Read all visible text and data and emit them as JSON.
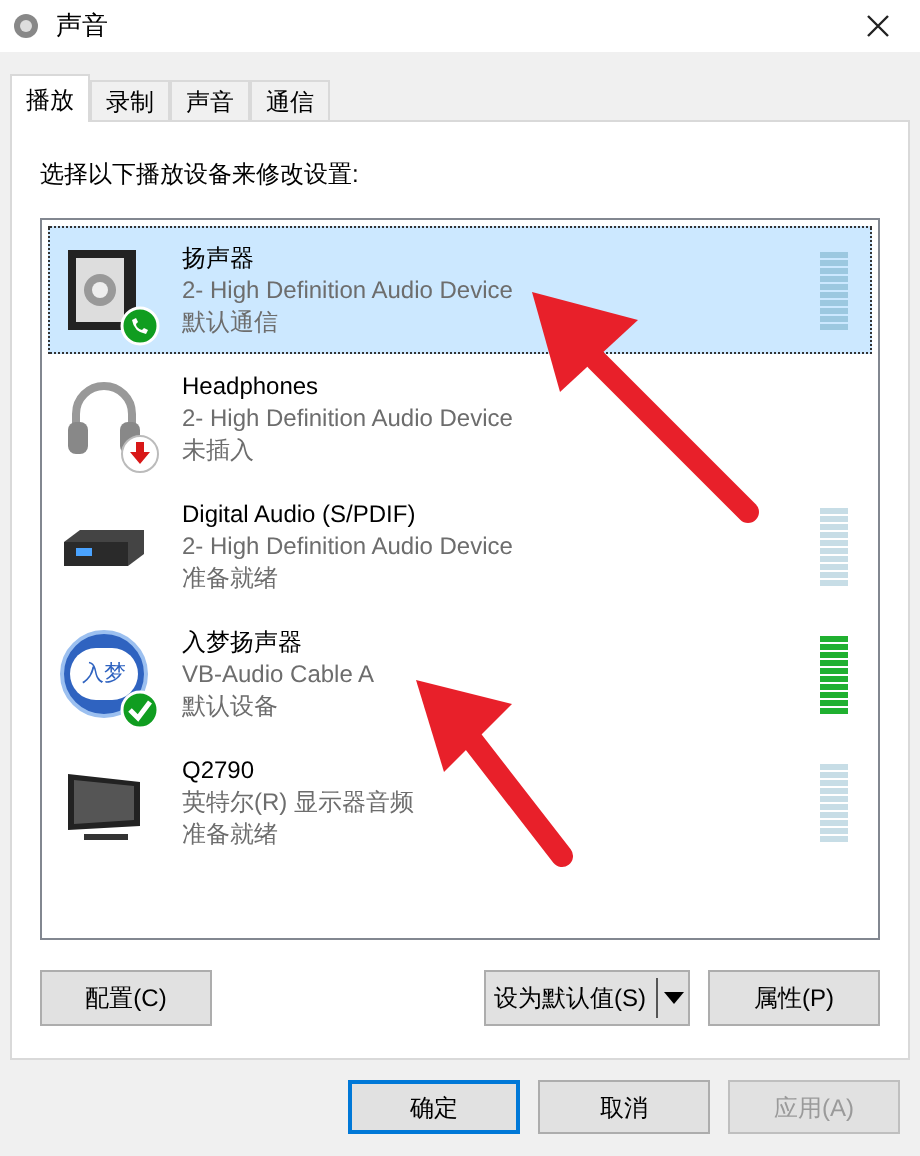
{
  "window": {
    "title": "声音"
  },
  "tabs": [
    {
      "label": "播放",
      "selected": true
    },
    {
      "label": "录制",
      "selected": false
    },
    {
      "label": "声音",
      "selected": false
    },
    {
      "label": "通信",
      "selected": false
    }
  ],
  "instruction": "选择以下播放设备来修改设置:",
  "devices": [
    {
      "kind": "speaker",
      "name": "扬声器",
      "driver": "2- High Definition Audio Device",
      "status": "默认通信",
      "selected": true,
      "meter": true
    },
    {
      "kind": "headphones",
      "name": "Headphones",
      "driver": "2- High Definition Audio Device",
      "status": "未插入",
      "selected": false,
      "meter": false
    },
    {
      "kind": "spdif",
      "name": "Digital Audio (S/PDIF)",
      "driver": "2- High Definition Audio Device",
      "status": "准备就绪",
      "selected": false,
      "meter": true
    },
    {
      "kind": "logo",
      "logo_text": "入梦",
      "name": "入梦扬声器",
      "driver": "VB-Audio Cable A",
      "status": "默认设备",
      "selected": false,
      "meter": true,
      "level": 1
    },
    {
      "kind": "monitor",
      "name": "Q2790",
      "driver": "英特尔(R) 显示器音频",
      "status": "准备就绪",
      "selected": false,
      "meter": true
    }
  ],
  "panel_buttons": {
    "configure": "配置(C)",
    "set_default": "设为默认值(S)",
    "properties": "属性(P)"
  },
  "dialog_buttons": [
    {
      "label": "确定",
      "focused": true,
      "disabled": false
    },
    {
      "label": "取消",
      "focused": false,
      "disabled": false
    },
    {
      "label": "应用(A)",
      "focused": false,
      "disabled": true
    }
  ]
}
